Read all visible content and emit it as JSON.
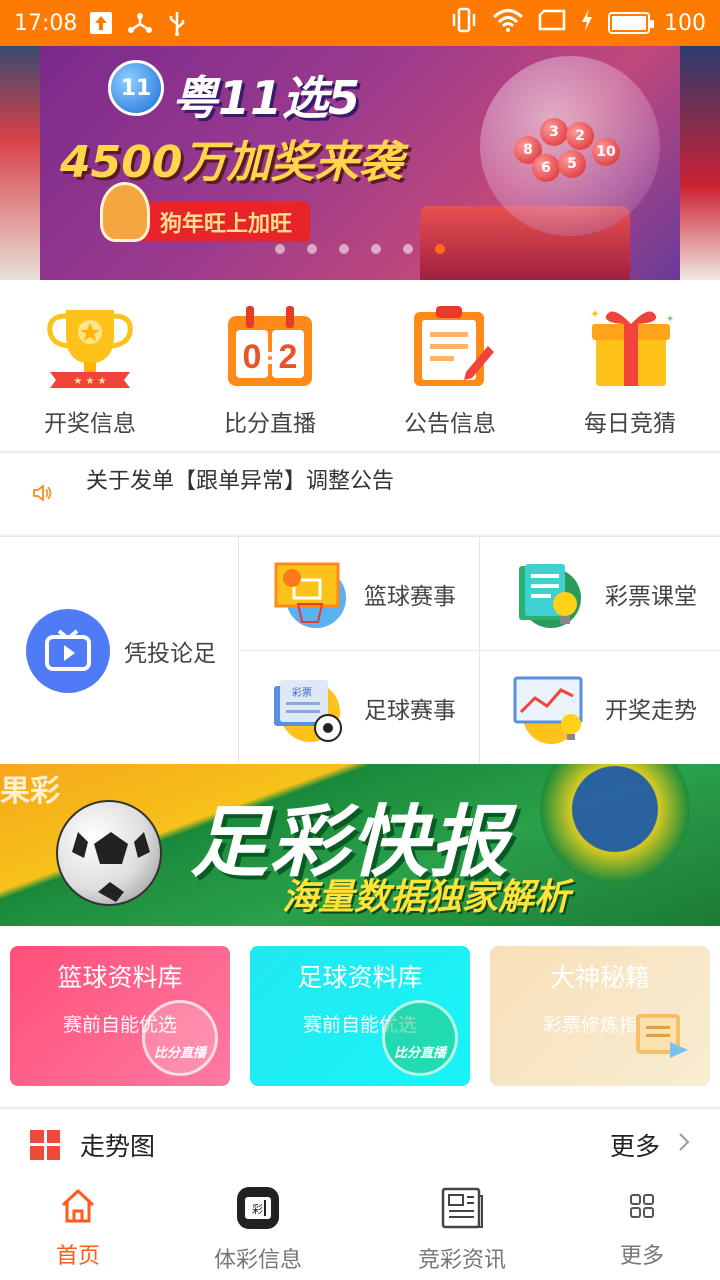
{
  "status_bar": {
    "time": "17:08",
    "battery": "100"
  },
  "banner": {
    "ball_text": "11",
    "title_line1": "粤11选5",
    "title_line2": "4500万加奖来袭",
    "ribbon": "狗年旺上加旺",
    "page_count": 6,
    "active_page": 6
  },
  "quick_menu": [
    {
      "label": "开奖信息",
      "icon": "trophy-icon"
    },
    {
      "label": "比分直播",
      "icon": "scoreboard-icon"
    },
    {
      "label": "公告信息",
      "icon": "notice-board-icon"
    },
    {
      "label": "每日竞猜",
      "icon": "gift-box-icon"
    }
  ],
  "notice": {
    "text": "关于发单【跟单异常】调整公告"
  },
  "feature_grid": {
    "left": {
      "label": "凭投论足",
      "icon": "tv-icon"
    },
    "cells": [
      {
        "label": "篮球赛事",
        "icon": "basketball-hoop-icon"
      },
      {
        "label": "彩票课堂",
        "icon": "lightbulb-book-icon"
      },
      {
        "label": "足球赛事",
        "icon": "lottery-ticket-icon"
      },
      {
        "label": "开奖走势",
        "icon": "trend-chart-icon"
      }
    ]
  },
  "banner2": {
    "title": "足彩快报",
    "subtitle": "海量数据独家解析"
  },
  "cards": [
    {
      "title": "篮球资料库",
      "subtitle": "赛前自能优选",
      "badge": "比分直播"
    },
    {
      "title": "足球资料库",
      "subtitle": "赛前自能优选",
      "badge": "比分直播"
    },
    {
      "title": "大神秘籍",
      "subtitle": "彩票修炼指南",
      "badge": ""
    }
  ],
  "trend": {
    "title": "走势图",
    "more": "更多"
  },
  "tabbar": [
    {
      "label": "首页",
      "icon": "home-icon",
      "active": true
    },
    {
      "label": "体彩信息",
      "icon": "lottery-ticket-icon",
      "active": false
    },
    {
      "label": "竞彩资讯",
      "icon": "newspaper-icon",
      "active": false
    },
    {
      "label": "更多",
      "icon": "grid-more-icon",
      "active": false
    }
  ],
  "colors": {
    "status_bar": "#ff7a00",
    "accent": "#ff5a1a",
    "card_basketball": "#ff4f7a",
    "card_football": "#18f4f8",
    "card_guide": "#f7e0b8"
  }
}
